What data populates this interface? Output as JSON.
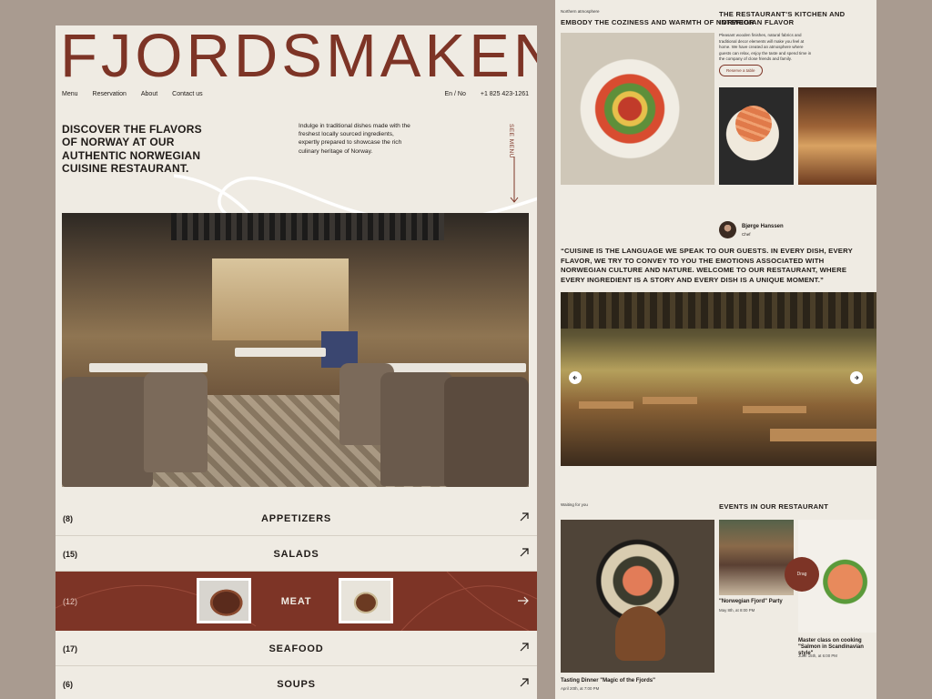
{
  "brand": "FJORDSMAKEN",
  "nav": {
    "menu": "Menu",
    "reservation": "Reservation",
    "about": "About",
    "contact": "Contact us",
    "lang": "En / No",
    "phone": "+1 825 423-1261"
  },
  "hero": {
    "title": "DISCOVER THE FLAVORS OF NORWAY AT OUR AUTHENTIC NORWEGIAN CUISINE RESTAURANT.",
    "text": "Indulge in traditional dishes made with the freshest locally sourced ingredients, expertly prepared to showcase the rich culinary heritage of Norway.",
    "see_menu": "SEE MENU"
  },
  "categories": [
    {
      "count": "(8)",
      "name": "APPETIZERS"
    },
    {
      "count": "(15)",
      "name": "SALADS"
    },
    {
      "count": "(12)",
      "name": "MEAT"
    },
    {
      "count": "(17)",
      "name": "SEAFOOD"
    },
    {
      "count": "(6)",
      "name": "SOUPS"
    }
  ],
  "atmosphere": {
    "kicker": "Northern atmosphere",
    "title": "EMBODY THE COZINESS AND WARMTH OF NORWEGIAN FLAVOR",
    "kitchen_title": "THE RESTAURANT'S KITCHEN AND INTERIOR",
    "kitchen_text": "Pleasant wooden finishes, natural fabrics and traditional decor elements will make you feel at home. We have created an atmosphere where guests can relax, enjoy the taste and spend time in the company of close friends and family.",
    "reserve": "Reserve a table"
  },
  "chef": {
    "name": "Bjørge Hanssen",
    "role": "Chef",
    "quote": "“CUISINE IS THE LANGUAGE WE SPEAK TO OUR GUESTS. IN EVERY DISH, EVERY FLAVOR, WE TRY TO CONVEY TO YOU THE EMOTIONS ASSOCIATED WITH NORWEGIAN CULTURE AND NATURE. WELCOME TO OUR RESTAURANT, WHERE EVERY INGREDIENT IS A STORY AND EVERY DISH IS A UNIQUE MOMENT.”"
  },
  "events": {
    "kicker": "Waiting for you",
    "title": "EVENTS IN OUR RESTAURANT",
    "drag": "Drag",
    "items": [
      {
        "title": "Tasting Dinner \"Magic of the Fjords\"",
        "date": "April 20th, at 7:00 PM"
      },
      {
        "title": "\"Norwegian Fjord\" Party",
        "date": "May 8th, at 8:00 PM"
      },
      {
        "title": "Master class on cooking \"Salmon in Scandinavian style\"",
        "date": "June 15th, at 6:00 PM"
      }
    ]
  }
}
